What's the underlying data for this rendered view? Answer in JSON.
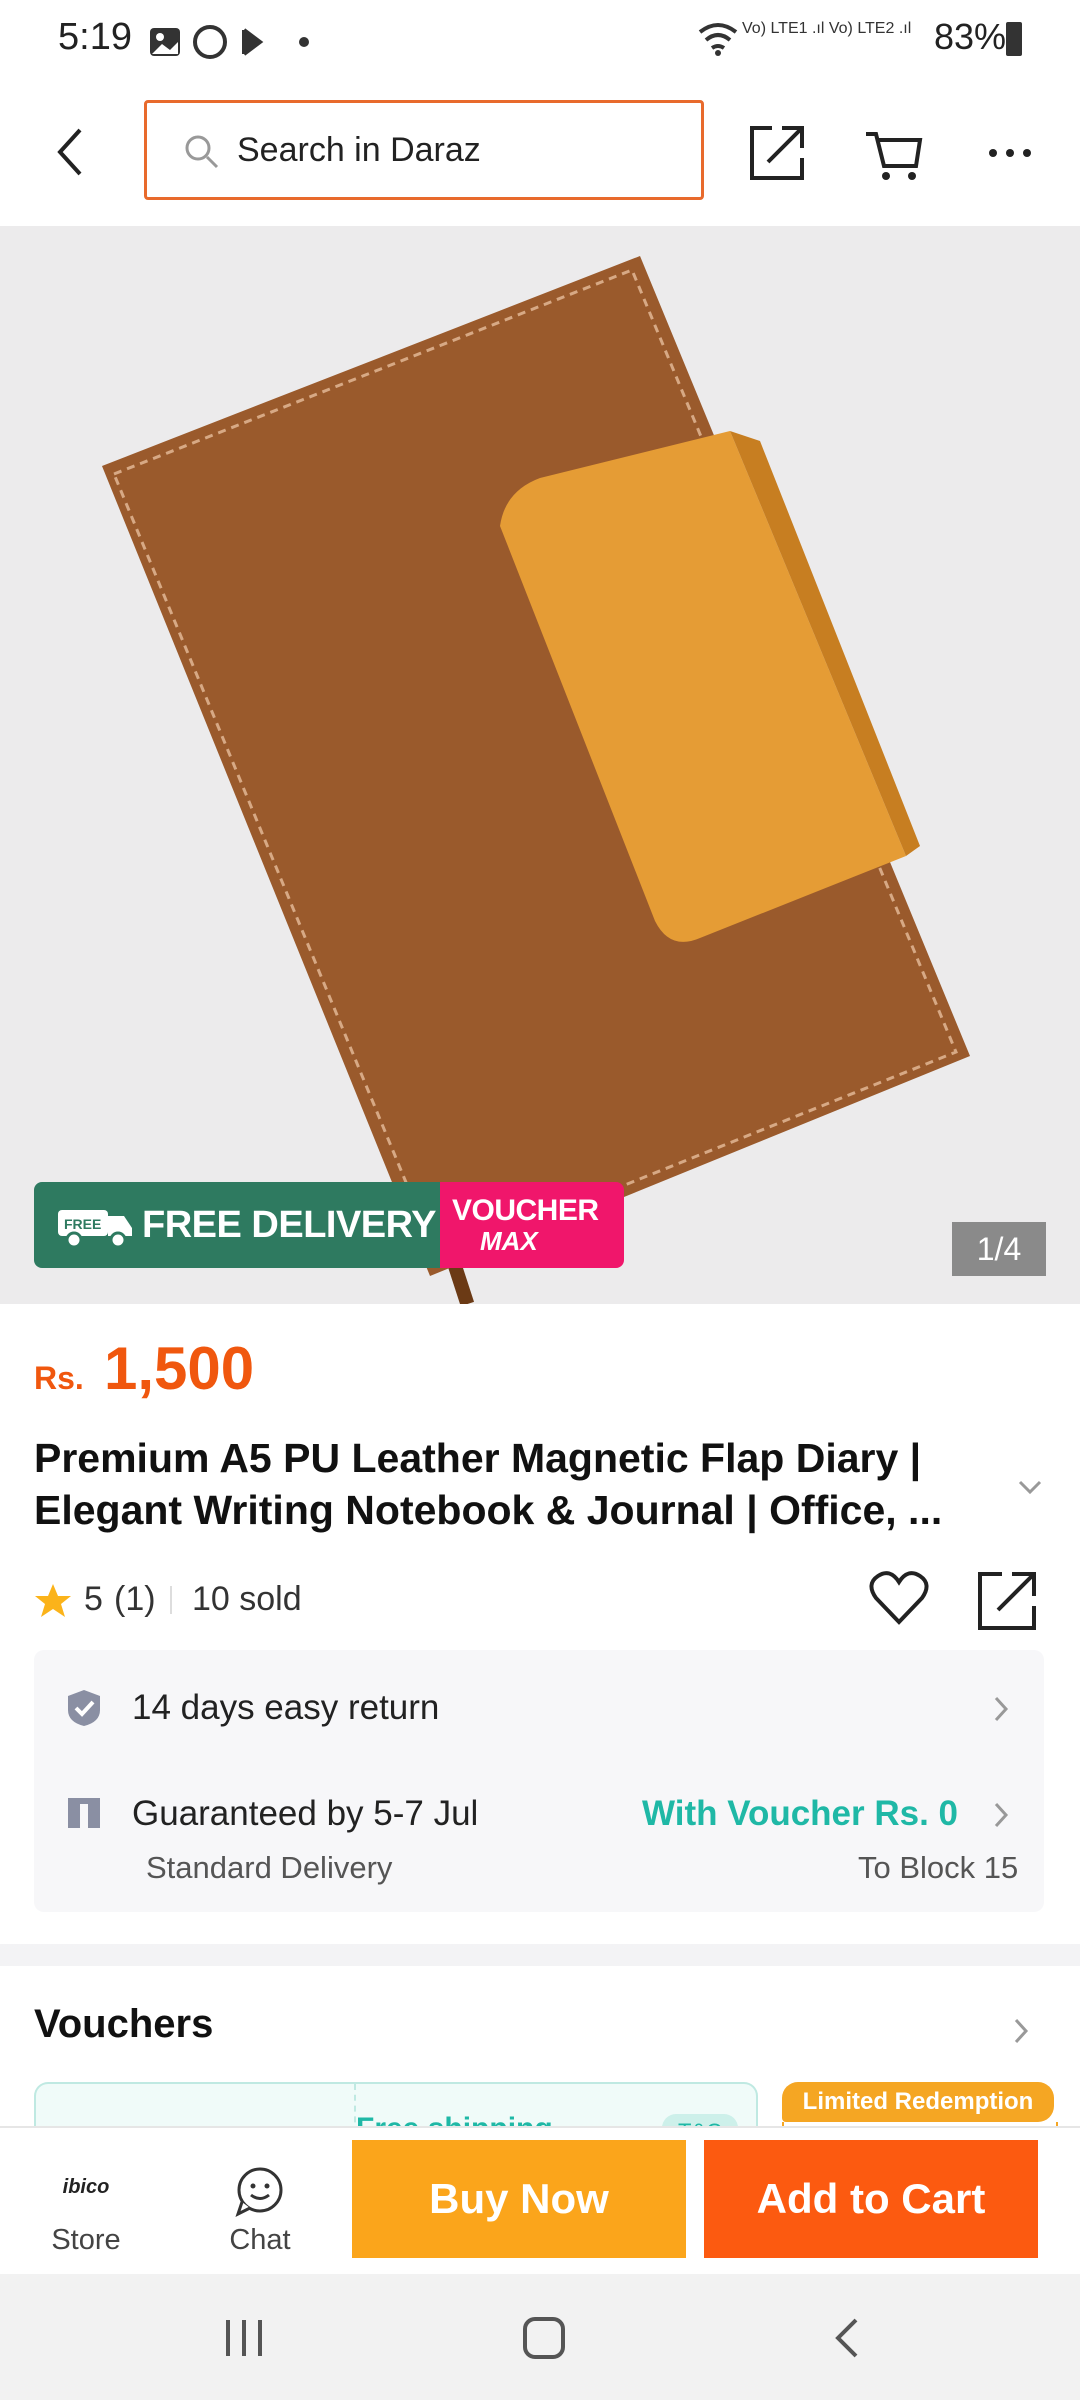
{
  "status_bar": {
    "time": "5:19",
    "signal_text": "Vo) LTE1 .ıl Vo) LTE2 .ıl",
    "battery": "83%"
  },
  "nav": {
    "back_icon": "back-arrow-icon",
    "search_placeholder": "Search in Daraz",
    "share_icon": "share-icon",
    "cart_icon": "cart-icon",
    "more_icon": "more-icon"
  },
  "hero": {
    "counter": "1/4",
    "badge_free": "FREE DELIVERY",
    "badge_free_small": "FREE",
    "badge_voucher_1": "VOUCHER",
    "badge_voucher_2": "MAX"
  },
  "product": {
    "currency": "Rs.",
    "price": "1,500",
    "title": "Premium A5 PU Leather Magnetic Flap Diary | Elegant Writing Notebook & Journal | Office, ...",
    "rating": "5",
    "rating_count": "(1)",
    "sold": "10 sold"
  },
  "info": {
    "return_text": "14 days easy return",
    "delivery_text": "Guaranteed by 5-7 Jul",
    "delivery_sub": "Standard Delivery",
    "voucher_text": "With Voucher Rs. 0",
    "block_text": "To Block 15"
  },
  "vouchers": {
    "title": "Vouchers",
    "limited": "Limited Redemption",
    "card_partial": "Free shipping",
    "tc": "T&C"
  },
  "bottom": {
    "store_label": "Store",
    "store_brand": "ibico",
    "chat_label": "Chat",
    "buy_now": "Buy Now",
    "add_to_cart": "Add to Cart"
  },
  "colors": {
    "brand_orange": "#f0570e",
    "buy_now": "#fba51b",
    "add_to_cart": "#fc5a10",
    "teal": "#1fb8a6",
    "free_green": "#2e7a60",
    "voucher_pink": "#f0166b"
  }
}
